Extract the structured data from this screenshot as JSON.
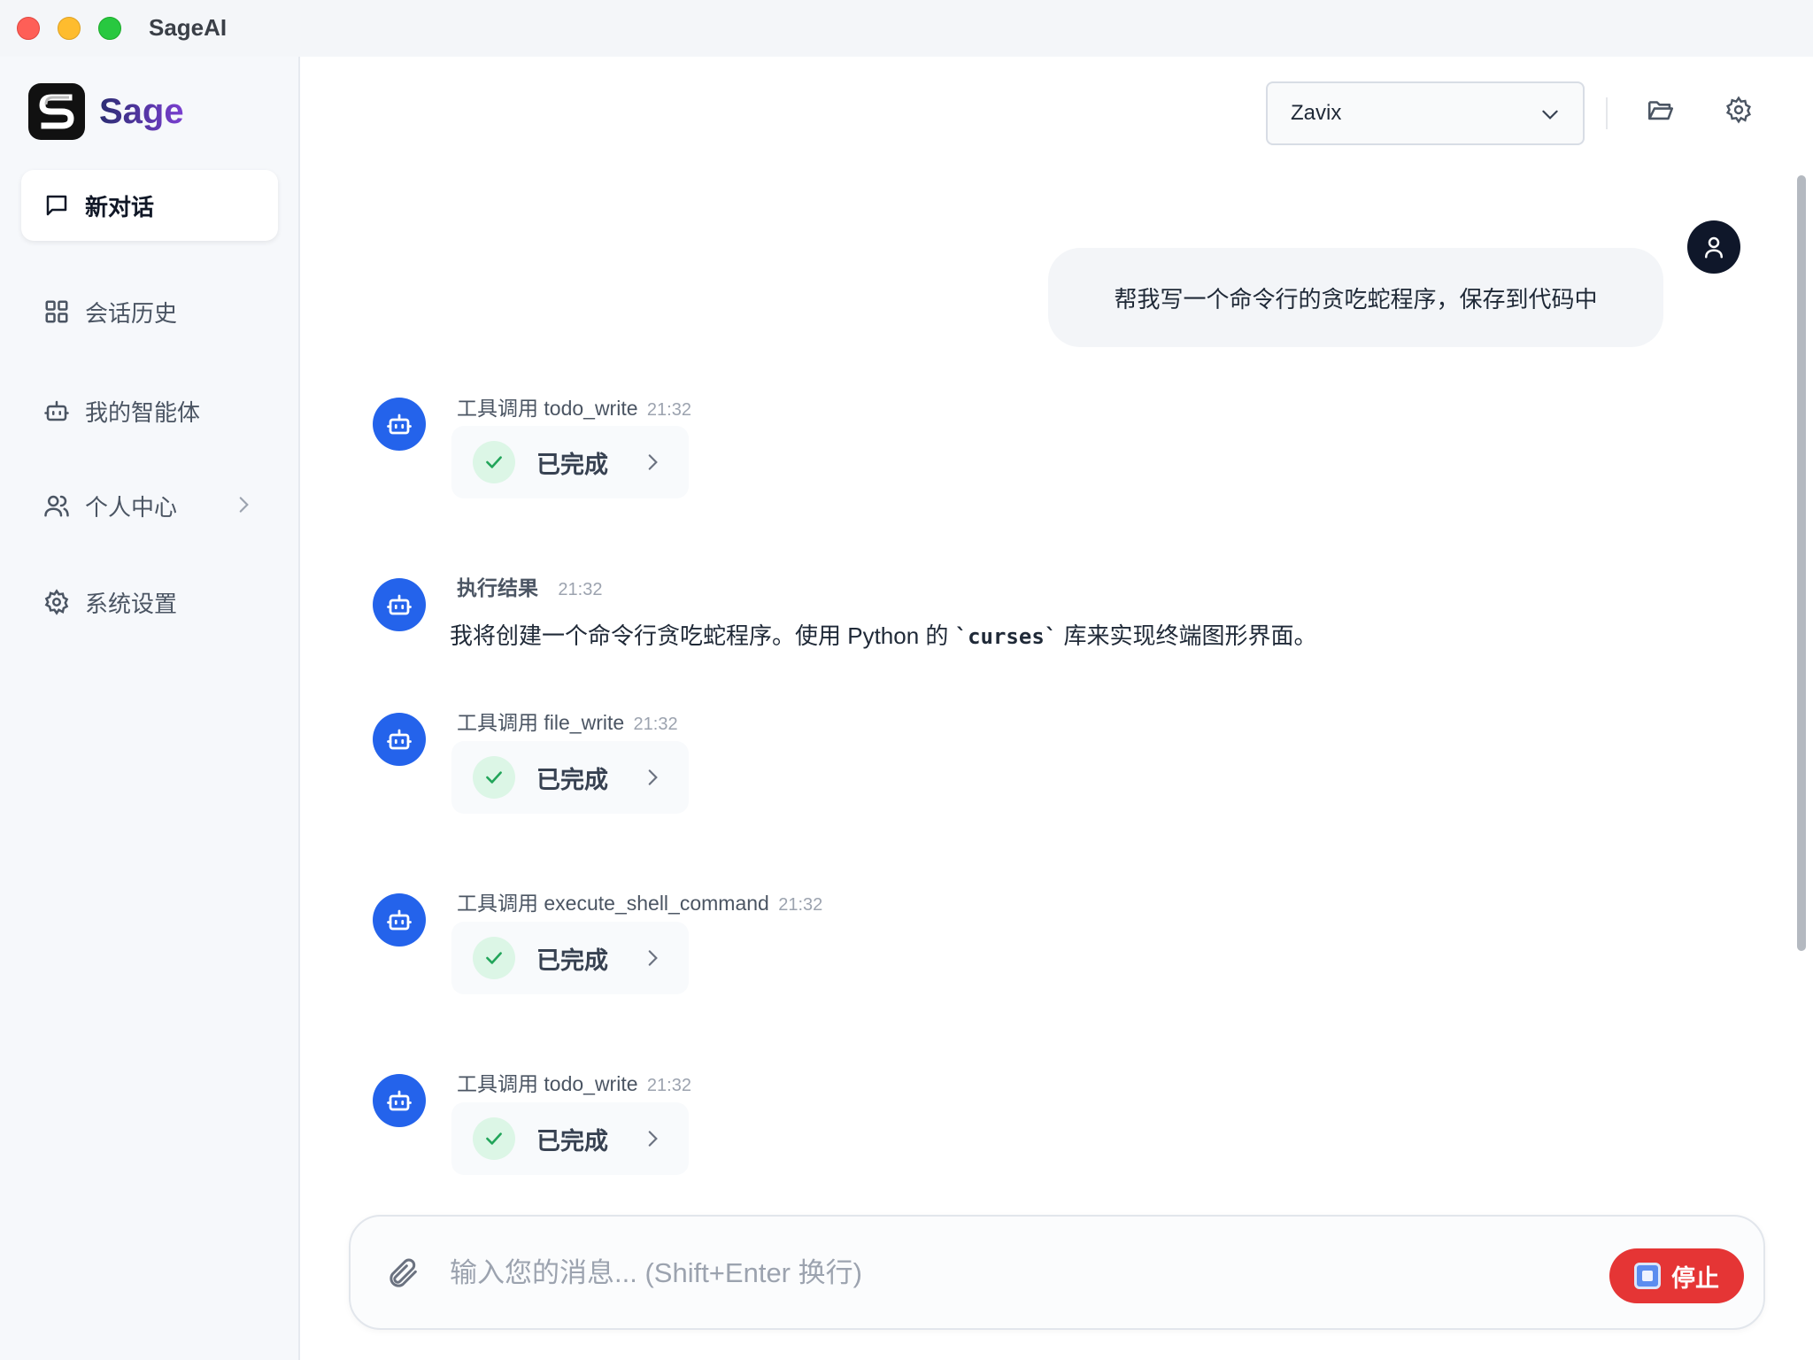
{
  "window": {
    "title": "SageAI"
  },
  "brand": {
    "name": "Sage"
  },
  "sidebar": {
    "items": [
      {
        "label": "新对话",
        "icon": "chat-bubble-icon",
        "active": true
      },
      {
        "label": "会话历史",
        "icon": "grid-icon"
      },
      {
        "label": "我的智能体",
        "icon": "robot-icon"
      },
      {
        "label": "个人中心",
        "icon": "users-icon",
        "has_submenu": true
      },
      {
        "label": "系统设置",
        "icon": "gear-icon"
      }
    ]
  },
  "header": {
    "model_value": "Zavix",
    "buttons": [
      "folder-icon",
      "gear-icon"
    ]
  },
  "chat": {
    "user_message": "帮我写一个命令行的贪吃蛇程序，保存到代码中",
    "messages": [
      {
        "prefix": "工具调用",
        "tool": "todo_write",
        "time": "21:32",
        "status": "已完成"
      },
      {
        "title": "执行结果",
        "time": "21:32",
        "text_before": "我将创建一个命令行贪吃蛇程序。使用 Python 的 ",
        "code": "`curses`",
        "text_after": " 库来实现终端图形界面。"
      },
      {
        "prefix": "工具调用",
        "tool": "file_write",
        "time": "21:32",
        "status": "已完成"
      },
      {
        "prefix": "工具调用",
        "tool": "execute_shell_command",
        "time": "21:32",
        "status": "已完成"
      },
      {
        "prefix": "工具调用",
        "tool": "todo_write",
        "time": "21:32",
        "status": "已完成"
      }
    ]
  },
  "composer": {
    "placeholder": "输入您的消息... (Shift+Enter 换行)",
    "stop_label": "停止"
  },
  "colors": {
    "accent": "#2463eb",
    "stop": "#e53535",
    "success": "#22a55a"
  }
}
